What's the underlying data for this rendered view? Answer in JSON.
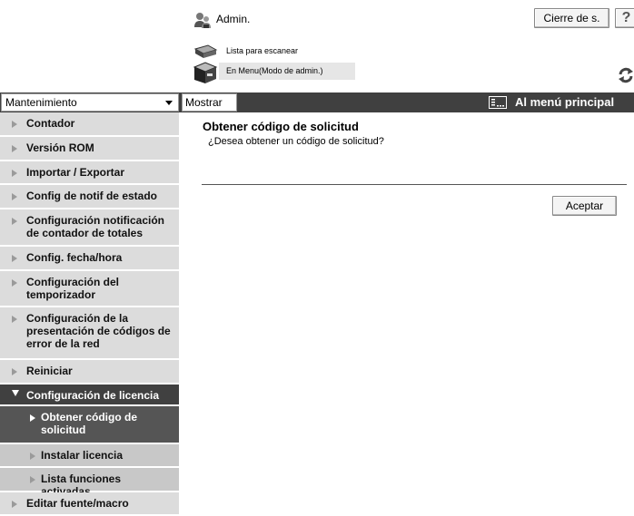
{
  "header": {
    "user_label": "Admin.",
    "logout_label": "Cierre de s.",
    "help_label": "?",
    "scan_list_label": "Lista para escanear",
    "mode_label": "En Menu(Modo de admin.)"
  },
  "toolbar": {
    "category_select": "Mantenimiento",
    "show_label": "Mostrar",
    "main_menu_label": "Al menú principal"
  },
  "sidebar": {
    "items": [
      {
        "label": "Contador"
      },
      {
        "label": "Versión ROM"
      },
      {
        "label": "Importar / Exportar"
      },
      {
        "label": "Config de notif de estado"
      },
      {
        "label": "Configuración notificación de contador de totales"
      },
      {
        "label": "Config. fecha/hora"
      },
      {
        "label": "Configuración del temporizador"
      },
      {
        "label": "Configuración de la presentación de códigos de error de la red"
      },
      {
        "label": "Reiniciar"
      },
      {
        "label": "Configuración de licencia"
      },
      {
        "label": "Obtener código de solicitud"
      },
      {
        "label": "Instalar licencia"
      },
      {
        "label": "Lista funciones activadas"
      },
      {
        "label": "Editar fuente/macro"
      }
    ]
  },
  "main": {
    "title": "Obtener código de solicitud",
    "question": "¿Desea obtener un código de solicitud?",
    "accept_label": "Aceptar"
  },
  "colors": {
    "toolbar_bg": "#404040",
    "sidebar_bg": "#dcdcdc",
    "sidebar_active_bg": "#404040",
    "sidebar_sub_bg": "#c8c8c8",
    "sidebar_current_bg": "#555555"
  },
  "icons": [
    "admin-user-icon",
    "scanner-icon",
    "printer-icon",
    "refresh-icon",
    "menu-icon"
  ]
}
